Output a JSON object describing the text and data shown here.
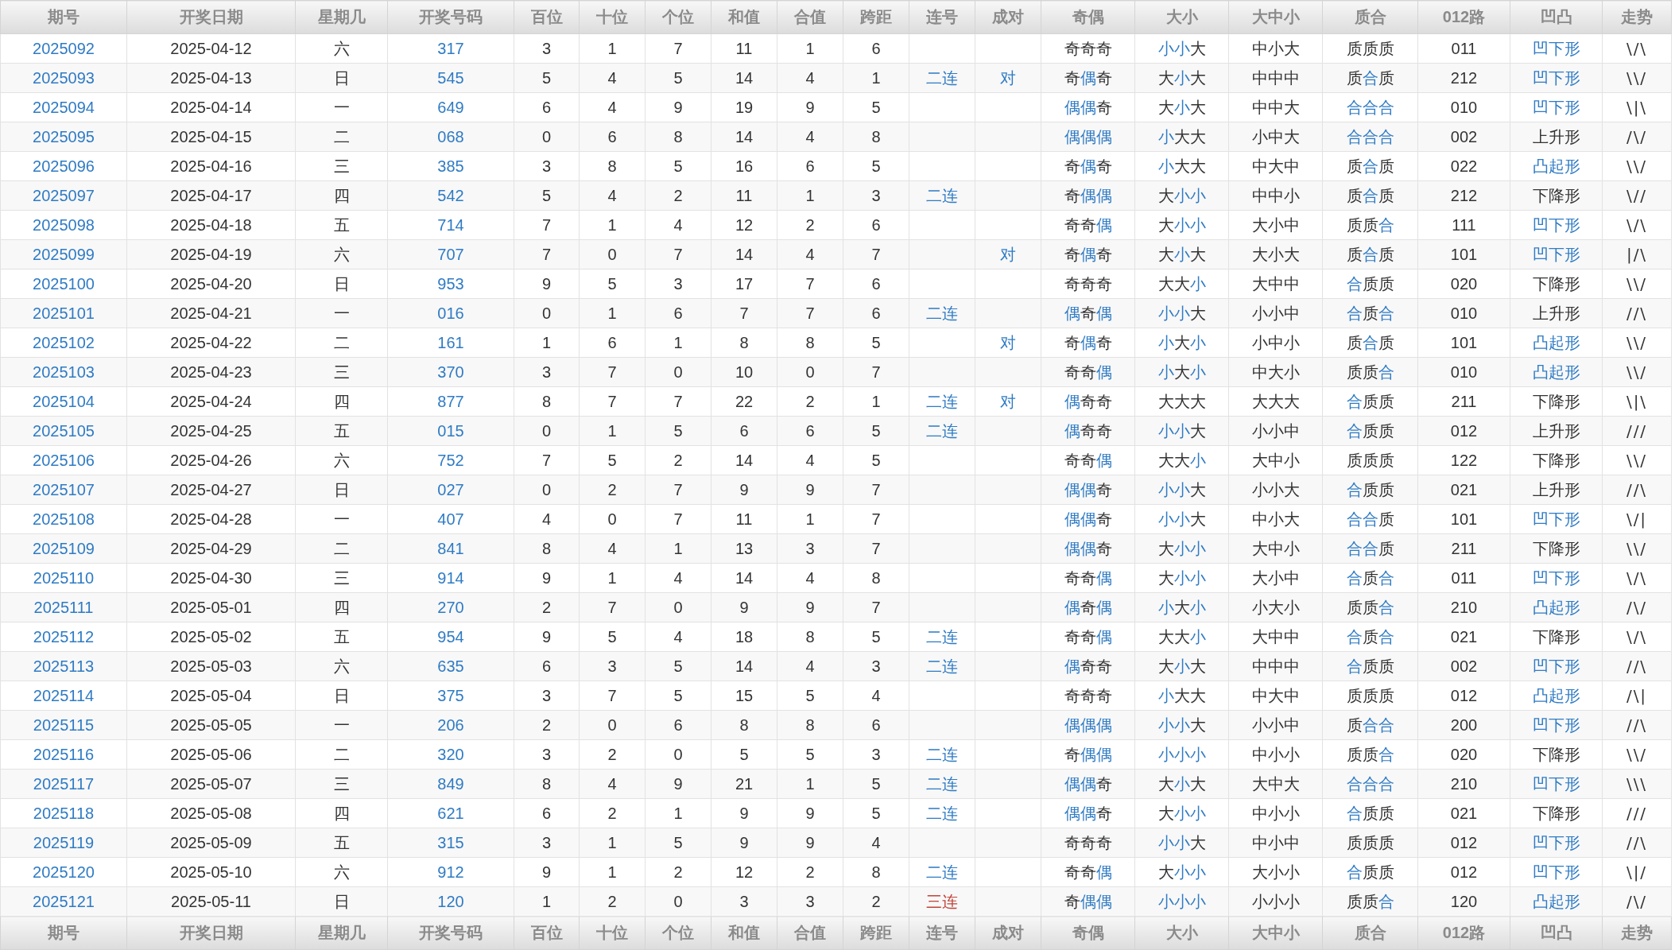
{
  "header_columns": [
    "期号",
    "开奖日期",
    "星期几",
    "开奖号码",
    "百位",
    "十位",
    "个位",
    "和值",
    "合值",
    "跨距",
    "连号",
    "成对",
    "奇偶",
    "大小",
    "大中小",
    "质合",
    "012路",
    "凹凸",
    "走势"
  ],
  "rows": [
    {
      "issue": "2025092",
      "date": "2025-04-12",
      "weekday": "六",
      "number": "317",
      "d1": "3",
      "d2": "1",
      "d3": "7",
      "sum": "11",
      "tail": "1",
      "span": "6",
      "odd_even": "奇奇奇",
      "odd_even_hl": [
        false,
        false,
        false
      ],
      "big_small": "小小大",
      "big_small_hl": [
        true,
        true,
        false
      ],
      "bms": "中小大",
      "prime": "质质质",
      "prime_hl": [
        false,
        false,
        false
      ],
      "route": "011",
      "shape": "凹下形",
      "shape_hl": true,
      "trend": "\\/\\"
    },
    {
      "issue": "2025093",
      "date": "2025-04-13",
      "weekday": "日",
      "number": "545",
      "d1": "5",
      "d2": "4",
      "d3": "5",
      "sum": "14",
      "tail": "4",
      "span": "1",
      "consecutive": {
        "text": "二连",
        "color": "#2f7bc4"
      },
      "pair": "对",
      "odd_even": "奇偶奇",
      "odd_even_hl": [
        false,
        true,
        false
      ],
      "big_small": "大小大",
      "big_small_hl": [
        false,
        true,
        false
      ],
      "bms": "中中中",
      "prime": "质合质",
      "prime_hl": [
        false,
        true,
        false
      ],
      "route": "212",
      "shape": "凹下形",
      "shape_hl": true,
      "trend": "\\\\/"
    },
    {
      "issue": "2025094",
      "date": "2025-04-14",
      "weekday": "一",
      "number": "649",
      "d1": "6",
      "d2": "4",
      "d3": "9",
      "sum": "19",
      "tail": "9",
      "span": "5",
      "odd_even": "偶偶奇",
      "odd_even_hl": [
        true,
        true,
        false
      ],
      "big_small": "大小大",
      "big_small_hl": [
        false,
        true,
        false
      ],
      "bms": "中中大",
      "prime": "合合合",
      "prime_hl": [
        true,
        true,
        true
      ],
      "route": "010",
      "shape": "凹下形",
      "shape_hl": true,
      "trend": "\\|\\"
    },
    {
      "issue": "2025095",
      "date": "2025-04-15",
      "weekday": "二",
      "number": "068",
      "d1": "0",
      "d2": "6",
      "d3": "8",
      "sum": "14",
      "tail": "4",
      "span": "8",
      "odd_even": "偶偶偶",
      "odd_even_hl": [
        true,
        true,
        true
      ],
      "big_small": "小大大",
      "big_small_hl": [
        true,
        false,
        false
      ],
      "bms": "小中大",
      "prime": "合合合",
      "prime_hl": [
        true,
        true,
        true
      ],
      "route": "002",
      "shape": "上升形",
      "shape_hl": false,
      "trend": "/\\/"
    },
    {
      "issue": "2025096",
      "date": "2025-04-16",
      "weekday": "三",
      "number": "385",
      "d1": "3",
      "d2": "8",
      "d3": "5",
      "sum": "16",
      "tail": "6",
      "span": "5",
      "odd_even": "奇偶奇",
      "odd_even_hl": [
        false,
        true,
        false
      ],
      "big_small": "小大大",
      "big_small_hl": [
        true,
        false,
        false
      ],
      "bms": "中大中",
      "prime": "质合质",
      "prime_hl": [
        false,
        true,
        false
      ],
      "route": "022",
      "shape": "凸起形",
      "shape_hl": true,
      "trend": "\\\\/"
    },
    {
      "issue": "2025097",
      "date": "2025-04-17",
      "weekday": "四",
      "number": "542",
      "d1": "5",
      "d2": "4",
      "d3": "2",
      "sum": "11",
      "tail": "1",
      "span": "3",
      "consecutive": {
        "text": "二连",
        "color": "#2f7bc4"
      },
      "odd_even": "奇偶偶",
      "odd_even_hl": [
        false,
        true,
        true
      ],
      "big_small": "大小小",
      "big_small_hl": [
        false,
        true,
        true
      ],
      "bms": "中中小",
      "prime": "质合质",
      "prime_hl": [
        false,
        true,
        false
      ],
      "route": "212",
      "shape": "下降形",
      "shape_hl": false,
      "trend": "\\//"
    },
    {
      "issue": "2025098",
      "date": "2025-04-18",
      "weekday": "五",
      "number": "714",
      "d1": "7",
      "d2": "1",
      "d3": "4",
      "sum": "12",
      "tail": "2",
      "span": "6",
      "odd_even": "奇奇偶",
      "odd_even_hl": [
        false,
        false,
        true
      ],
      "big_small": "大小小",
      "big_small_hl": [
        false,
        true,
        true
      ],
      "bms": "大小中",
      "prime": "质质合",
      "prime_hl": [
        false,
        false,
        true
      ],
      "route": "111",
      "shape": "凹下形",
      "shape_hl": true,
      "trend": "\\/\\"
    },
    {
      "issue": "2025099",
      "date": "2025-04-19",
      "weekday": "六",
      "number": "707",
      "d1": "7",
      "d2": "0",
      "d3": "7",
      "sum": "14",
      "tail": "4",
      "span": "7",
      "pair": "对",
      "odd_even": "奇偶奇",
      "odd_even_hl": [
        false,
        true,
        false
      ],
      "big_small": "大小大",
      "big_small_hl": [
        false,
        true,
        false
      ],
      "bms": "大小大",
      "prime": "质合质",
      "prime_hl": [
        false,
        true,
        false
      ],
      "route": "101",
      "shape": "凹下形",
      "shape_hl": true,
      "trend": "|/\\"
    },
    {
      "issue": "2025100",
      "date": "2025-04-20",
      "weekday": "日",
      "number": "953",
      "d1": "9",
      "d2": "5",
      "d3": "3",
      "sum": "17",
      "tail": "7",
      "span": "6",
      "odd_even": "奇奇奇",
      "odd_even_hl": [
        false,
        false,
        false
      ],
      "big_small": "大大小",
      "big_small_hl": [
        false,
        false,
        true
      ],
      "bms": "大中中",
      "prime": "合质质",
      "prime_hl": [
        true,
        false,
        false
      ],
      "route": "020",
      "shape": "下降形",
      "shape_hl": false,
      "trend": "\\\\/"
    },
    {
      "issue": "2025101",
      "date": "2025-04-21",
      "weekday": "一",
      "number": "016",
      "d1": "0",
      "d2": "1",
      "d3": "6",
      "sum": "7",
      "tail": "7",
      "span": "6",
      "consecutive": {
        "text": "二连",
        "color": "#2f7bc4"
      },
      "odd_even": "偶奇偶",
      "odd_even_hl": [
        true,
        false,
        true
      ],
      "big_small": "小小大",
      "big_small_hl": [
        true,
        true,
        false
      ],
      "bms": "小小中",
      "prime": "合质合",
      "prime_hl": [
        true,
        false,
        true
      ],
      "route": "010",
      "shape": "上升形",
      "shape_hl": false,
      "trend": "//\\"
    },
    {
      "issue": "2025102",
      "date": "2025-04-22",
      "weekday": "二",
      "number": "161",
      "d1": "1",
      "d2": "6",
      "d3": "1",
      "sum": "8",
      "tail": "8",
      "span": "5",
      "pair": "对",
      "odd_even": "奇偶奇",
      "odd_even_hl": [
        false,
        true,
        false
      ],
      "big_small": "小大小",
      "big_small_hl": [
        true,
        false,
        true
      ],
      "bms": "小中小",
      "prime": "质合质",
      "prime_hl": [
        false,
        true,
        false
      ],
      "route": "101",
      "shape": "凸起形",
      "shape_hl": true,
      "trend": "\\\\/"
    },
    {
      "issue": "2025103",
      "date": "2025-04-23",
      "weekday": "三",
      "number": "370",
      "d1": "3",
      "d2": "7",
      "d3": "0",
      "sum": "10",
      "tail": "0",
      "span": "7",
      "odd_even": "奇奇偶",
      "odd_even_hl": [
        false,
        false,
        true
      ],
      "big_small": "小大小",
      "big_small_hl": [
        true,
        false,
        true
      ],
      "bms": "中大小",
      "prime": "质质合",
      "prime_hl": [
        false,
        false,
        true
      ],
      "route": "010",
      "shape": "凸起形",
      "shape_hl": true,
      "trend": "\\\\/"
    },
    {
      "issue": "2025104",
      "date": "2025-04-24",
      "weekday": "四",
      "number": "877",
      "d1": "8",
      "d2": "7",
      "d3": "7",
      "sum": "22",
      "tail": "2",
      "span": "1",
      "consecutive": {
        "text": "二连",
        "color": "#2f7bc4"
      },
      "pair": "对",
      "odd_even": "偶奇奇",
      "odd_even_hl": [
        true,
        false,
        false
      ],
      "big_small": "大大大",
      "big_small_hl": [
        false,
        false,
        false
      ],
      "bms": "大大大",
      "prime": "合质质",
      "prime_hl": [
        true,
        false,
        false
      ],
      "route": "211",
      "shape": "下降形",
      "shape_hl": false,
      "trend": "\\|\\"
    },
    {
      "issue": "2025105",
      "date": "2025-04-25",
      "weekday": "五",
      "number": "015",
      "d1": "0",
      "d2": "1",
      "d3": "5",
      "sum": "6",
      "tail": "6",
      "span": "5",
      "consecutive": {
        "text": "二连",
        "color": "#2f7bc4"
      },
      "odd_even": "偶奇奇",
      "odd_even_hl": [
        true,
        false,
        false
      ],
      "big_small": "小小大",
      "big_small_hl": [
        true,
        true,
        false
      ],
      "bms": "小小中",
      "prime": "合质质",
      "prime_hl": [
        true,
        false,
        false
      ],
      "route": "012",
      "shape": "上升形",
      "shape_hl": false,
      "trend": "///"
    },
    {
      "issue": "2025106",
      "date": "2025-04-26",
      "weekday": "六",
      "number": "752",
      "d1": "7",
      "d2": "5",
      "d3": "2",
      "sum": "14",
      "tail": "4",
      "span": "5",
      "odd_even": "奇奇偶",
      "odd_even_hl": [
        false,
        false,
        true
      ],
      "big_small": "大大小",
      "big_small_hl": [
        false,
        false,
        true
      ],
      "bms": "大中小",
      "prime": "质质质",
      "prime_hl": [
        false,
        false,
        false
      ],
      "route": "122",
      "shape": "下降形",
      "shape_hl": false,
      "trend": "\\\\/"
    },
    {
      "issue": "2025107",
      "date": "2025-04-27",
      "weekday": "日",
      "number": "027",
      "d1": "0",
      "d2": "2",
      "d3": "7",
      "sum": "9",
      "tail": "9",
      "span": "7",
      "odd_even": "偶偶奇",
      "odd_even_hl": [
        true,
        true,
        false
      ],
      "big_small": "小小大",
      "big_small_hl": [
        true,
        true,
        false
      ],
      "bms": "小小大",
      "prime": "合质质",
      "prime_hl": [
        true,
        false,
        false
      ],
      "route": "021",
      "shape": "上升形",
      "shape_hl": false,
      "trend": "//\\"
    },
    {
      "issue": "2025108",
      "date": "2025-04-28",
      "weekday": "一",
      "number": "407",
      "d1": "4",
      "d2": "0",
      "d3": "7",
      "sum": "11",
      "tail": "1",
      "span": "7",
      "odd_even": "偶偶奇",
      "odd_even_hl": [
        true,
        true,
        false
      ],
      "big_small": "小小大",
      "big_small_hl": [
        true,
        true,
        false
      ],
      "bms": "中小大",
      "prime": "合合质",
      "prime_hl": [
        true,
        true,
        false
      ],
      "route": "101",
      "shape": "凹下形",
      "shape_hl": true,
      "trend": "\\/|"
    },
    {
      "issue": "2025109",
      "date": "2025-04-29",
      "weekday": "二",
      "number": "841",
      "d1": "8",
      "d2": "4",
      "d3": "1",
      "sum": "13",
      "tail": "3",
      "span": "7",
      "odd_even": "偶偶奇",
      "odd_even_hl": [
        true,
        true,
        false
      ],
      "big_small": "大小小",
      "big_small_hl": [
        false,
        true,
        true
      ],
      "bms": "大中小",
      "prime": "合合质",
      "prime_hl": [
        true,
        true,
        false
      ],
      "route": "211",
      "shape": "下降形",
      "shape_hl": false,
      "trend": "\\\\/"
    },
    {
      "issue": "2025110",
      "date": "2025-04-30",
      "weekday": "三",
      "number": "914",
      "d1": "9",
      "d2": "1",
      "d3": "4",
      "sum": "14",
      "tail": "4",
      "span": "8",
      "odd_even": "奇奇偶",
      "odd_even_hl": [
        false,
        false,
        true
      ],
      "big_small": "大小小",
      "big_small_hl": [
        false,
        true,
        true
      ],
      "bms": "大小中",
      "prime": "合质合",
      "prime_hl": [
        true,
        false,
        true
      ],
      "route": "011",
      "shape": "凹下形",
      "shape_hl": true,
      "trend": "\\/\\"
    },
    {
      "issue": "2025111",
      "date": "2025-05-01",
      "weekday": "四",
      "number": "270",
      "d1": "2",
      "d2": "7",
      "d3": "0",
      "sum": "9",
      "tail": "9",
      "span": "7",
      "odd_even": "偶奇偶",
      "odd_even_hl": [
        true,
        false,
        true
      ],
      "big_small": "小大小",
      "big_small_hl": [
        true,
        false,
        true
      ],
      "bms": "小大小",
      "prime": "质质合",
      "prime_hl": [
        false,
        false,
        true
      ],
      "route": "210",
      "shape": "凸起形",
      "shape_hl": true,
      "trend": "/\\/"
    },
    {
      "issue": "2025112",
      "date": "2025-05-02",
      "weekday": "五",
      "number": "954",
      "d1": "9",
      "d2": "5",
      "d3": "4",
      "sum": "18",
      "tail": "8",
      "span": "5",
      "consecutive": {
        "text": "二连",
        "color": "#2f7bc4"
      },
      "odd_even": "奇奇偶",
      "odd_even_hl": [
        false,
        false,
        true
      ],
      "big_small": "大大小",
      "big_small_hl": [
        false,
        false,
        true
      ],
      "bms": "大中中",
      "prime": "合质合",
      "prime_hl": [
        true,
        false,
        true
      ],
      "route": "021",
      "shape": "下降形",
      "shape_hl": false,
      "trend": "\\/\\"
    },
    {
      "issue": "2025113",
      "date": "2025-05-03",
      "weekday": "六",
      "number": "635",
      "d1": "6",
      "d2": "3",
      "d3": "5",
      "sum": "14",
      "tail": "4",
      "span": "3",
      "consecutive": {
        "text": "二连",
        "color": "#2f7bc4"
      },
      "odd_even": "偶奇奇",
      "odd_even_hl": [
        true,
        false,
        false
      ],
      "big_small": "大小大",
      "big_small_hl": [
        false,
        true,
        false
      ],
      "bms": "中中中",
      "prime": "合质质",
      "prime_hl": [
        true,
        false,
        false
      ],
      "route": "002",
      "shape": "凹下形",
      "shape_hl": true,
      "trend": "//\\"
    },
    {
      "issue": "2025114",
      "date": "2025-05-04",
      "weekday": "日",
      "number": "375",
      "d1": "3",
      "d2": "7",
      "d3": "5",
      "sum": "15",
      "tail": "5",
      "span": "4",
      "odd_even": "奇奇奇",
      "odd_even_hl": [
        false,
        false,
        false
      ],
      "big_small": "小大大",
      "big_small_hl": [
        true,
        false,
        false
      ],
      "bms": "中大中",
      "prime": "质质质",
      "prime_hl": [
        false,
        false,
        false
      ],
      "route": "012",
      "shape": "凸起形",
      "shape_hl": true,
      "trend": "/\\|"
    },
    {
      "issue": "2025115",
      "date": "2025-05-05",
      "weekday": "一",
      "number": "206",
      "d1": "2",
      "d2": "0",
      "d3": "6",
      "sum": "8",
      "tail": "8",
      "span": "6",
      "odd_even": "偶偶偶",
      "odd_even_hl": [
        true,
        true,
        true
      ],
      "big_small": "小小大",
      "big_small_hl": [
        true,
        true,
        false
      ],
      "bms": "小小中",
      "prime": "质合合",
      "prime_hl": [
        false,
        true,
        true
      ],
      "route": "200",
      "shape": "凹下形",
      "shape_hl": true,
      "trend": "//\\"
    },
    {
      "issue": "2025116",
      "date": "2025-05-06",
      "weekday": "二",
      "number": "320",
      "d1": "3",
      "d2": "2",
      "d3": "0",
      "sum": "5",
      "tail": "5",
      "span": "3",
      "consecutive": {
        "text": "二连",
        "color": "#2f7bc4"
      },
      "odd_even": "奇偶偶",
      "odd_even_hl": [
        false,
        true,
        true
      ],
      "big_small": "小小小",
      "big_small_hl": [
        true,
        true,
        true
      ],
      "bms": "中小小",
      "prime": "质质合",
      "prime_hl": [
        false,
        false,
        true
      ],
      "route": "020",
      "shape": "下降形",
      "shape_hl": false,
      "trend": "\\\\/"
    },
    {
      "issue": "2025117",
      "date": "2025-05-07",
      "weekday": "三",
      "number": "849",
      "d1": "8",
      "d2": "4",
      "d3": "9",
      "sum": "21",
      "tail": "1",
      "span": "5",
      "consecutive": {
        "text": "二连",
        "color": "#2f7bc4"
      },
      "odd_even": "偶偶奇",
      "odd_even_hl": [
        true,
        true,
        false
      ],
      "big_small": "大小大",
      "big_small_hl": [
        false,
        true,
        false
      ],
      "bms": "大中大",
      "prime": "合合合",
      "prime_hl": [
        true,
        true,
        true
      ],
      "route": "210",
      "shape": "凹下形",
      "shape_hl": true,
      "trend": "\\\\\\"
    },
    {
      "issue": "2025118",
      "date": "2025-05-08",
      "weekday": "四",
      "number": "621",
      "d1": "6",
      "d2": "2",
      "d3": "1",
      "sum": "9",
      "tail": "9",
      "span": "5",
      "consecutive": {
        "text": "二连",
        "color": "#2f7bc4"
      },
      "odd_even": "偶偶奇",
      "odd_even_hl": [
        true,
        true,
        false
      ],
      "big_small": "大小小",
      "big_small_hl": [
        false,
        true,
        true
      ],
      "bms": "中小小",
      "prime": "合质质",
      "prime_hl": [
        true,
        false,
        false
      ],
      "route": "021",
      "shape": "下降形",
      "shape_hl": false,
      "trend": "///"
    },
    {
      "issue": "2025119",
      "date": "2025-05-09",
      "weekday": "五",
      "number": "315",
      "d1": "3",
      "d2": "1",
      "d3": "5",
      "sum": "9",
      "tail": "9",
      "span": "4",
      "odd_even": "奇奇奇",
      "odd_even_hl": [
        false,
        false,
        false
      ],
      "big_small": "小小大",
      "big_small_hl": [
        true,
        true,
        false
      ],
      "bms": "中小中",
      "prime": "质质质",
      "prime_hl": [
        false,
        false,
        false
      ],
      "route": "012",
      "shape": "凹下形",
      "shape_hl": true,
      "trend": "//\\"
    },
    {
      "issue": "2025120",
      "date": "2025-05-10",
      "weekday": "六",
      "number": "912",
      "d1": "9",
      "d2": "1",
      "d3": "2",
      "sum": "12",
      "tail": "2",
      "span": "8",
      "consecutive": {
        "text": "二连",
        "color": "#2f7bc4"
      },
      "odd_even": "奇奇偶",
      "odd_even_hl": [
        false,
        false,
        true
      ],
      "big_small": "大小小",
      "big_small_hl": [
        false,
        true,
        true
      ],
      "bms": "大小小",
      "prime": "合质质",
      "prime_hl": [
        true,
        false,
        false
      ],
      "route": "012",
      "shape": "凹下形",
      "shape_hl": true,
      "trend": "\\|/"
    },
    {
      "issue": "2025121",
      "date": "2025-05-11",
      "weekday": "日",
      "number": "120",
      "d1": "1",
      "d2": "2",
      "d3": "0",
      "sum": "3",
      "tail": "3",
      "span": "2",
      "consecutive": {
        "text": "三连",
        "color": "#c0453a"
      },
      "odd_even": "奇偶偶",
      "odd_even_hl": [
        false,
        true,
        true
      ],
      "big_small": "小小小",
      "big_small_hl": [
        true,
        true,
        true
      ],
      "bms": "小小小",
      "prime": "质质合",
      "prime_hl": [
        false,
        false,
        true
      ],
      "route": "120",
      "shape": "凸起形",
      "shape_hl": true,
      "trend": "/\\/"
    }
  ],
  "footer_columns": [
    "期号",
    "开奖日期",
    "星期几",
    "开奖号码",
    "百位",
    "十位",
    "个位",
    "和值",
    "合值",
    "跨距",
    "连号",
    "成对",
    "奇偶",
    "大小",
    "大中小",
    "质合",
    "012路",
    "凹凸",
    "走势"
  ]
}
